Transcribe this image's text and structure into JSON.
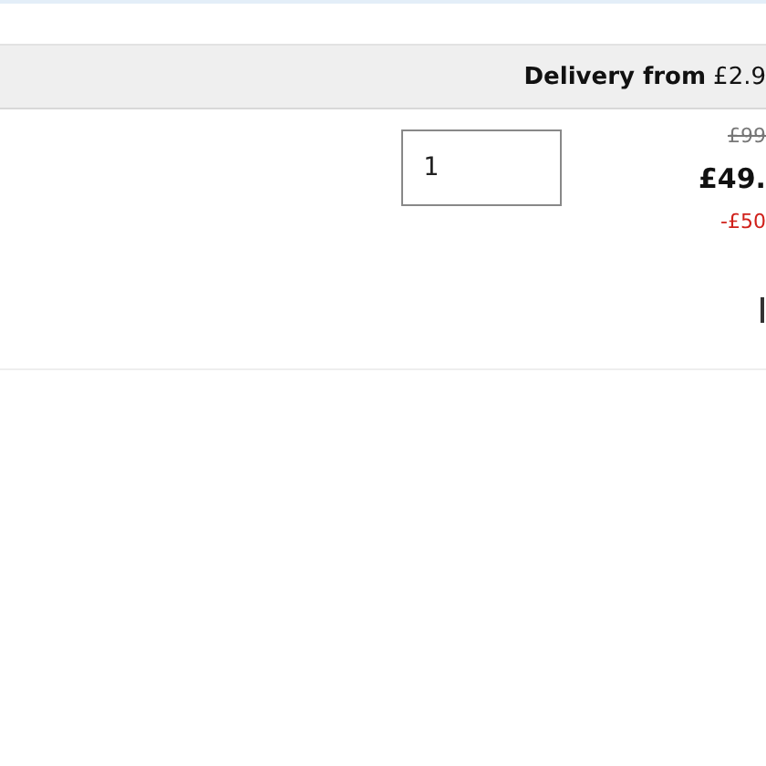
{
  "delivery_bar": {
    "label": "Delivery from",
    "price": "£2.9"
  },
  "item": {
    "quantity": "1",
    "was_price": "£99",
    "price": "£49.",
    "saving": "-£50"
  }
}
